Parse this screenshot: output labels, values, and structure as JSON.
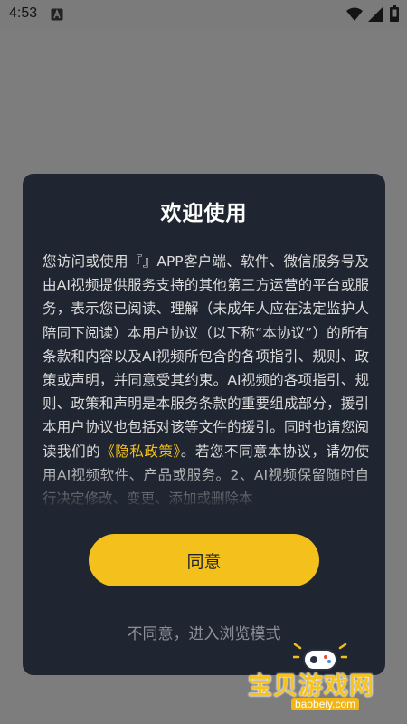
{
  "status_bar": {
    "time": "4:53"
  },
  "dialog": {
    "title": "欢迎使用",
    "body_before_link": "您访问或使用『』APP客户端、软件、微信服务号及由AI视频提供服务支持的其他第三方运营的平台或服务，表示您已阅读、理解（未成年人应在法定监护人陪同下阅读）本用户协议（以下称“本协议”）的所有条款和内容以及AI视频所包含的各项指引、规则、政策或声明，并同意受其约束。AI视频的各项指引、规则、政策和声明是本服务条款的重要组成部分，援引本用户协议也包括对该等文件的援引。同时也请您阅读我们的",
    "privacy_link": "《隐私政策》",
    "body_after_link": "。若您不同意本协议，请勿使用AI视频软件、产品或服务。2、AI视频保留随时自行决定修改、变更、添加或删除本",
    "agree_label": "同意",
    "decline_label": "不同意，进入浏览模式"
  },
  "watermark": {
    "name": "宝贝游戏网",
    "domain": "baobeiy.com"
  },
  "colors": {
    "accent": "#f3c01c",
    "dialog_bg": "#202631",
    "overlay": "#7d7d7d"
  }
}
